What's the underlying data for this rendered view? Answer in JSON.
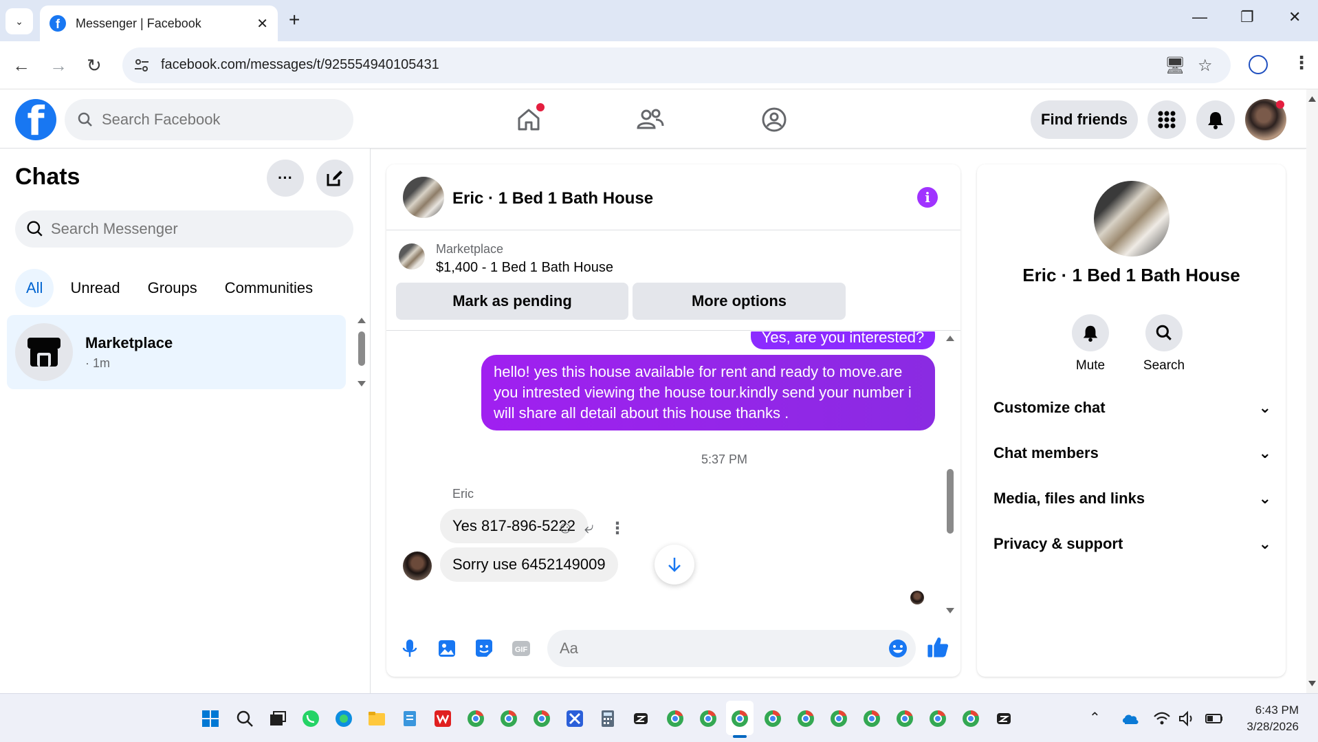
{
  "browser": {
    "tab_title": "Messenger | Facebook",
    "url": "facebook.com/messages/t/925554940105431"
  },
  "fb": {
    "search_placeholder": "Search Facebook",
    "find_friends": "Find friends"
  },
  "sidebar": {
    "title": "Chats",
    "search_placeholder": "Search Messenger",
    "filters": [
      "All",
      "Unread",
      "Groups",
      "Communities"
    ],
    "active_filter": "All",
    "chats": [
      {
        "name": "Marketplace",
        "meta": "· 1m"
      }
    ]
  },
  "conversation": {
    "title": "Eric · 1 Bed 1 Bath House",
    "listing": {
      "label": "Marketplace",
      "price_title": "$1,400 - 1 Bed 1 Bath House",
      "mark_pending": "Mark as pending",
      "more_options": "More options"
    },
    "messages": {
      "out_partial": "Yes, are you interested?",
      "out_main": "hello! yes this house available for rent and ready to move.are you intrested viewing the house tour.kindly send your number i will share all detail about this house thanks .",
      "timestamp": "5:37 PM",
      "sender": "Eric",
      "in_1": "Yes 817-896-5222",
      "in_2": "Sorry use 6452149009"
    },
    "composer_placeholder": "Aa"
  },
  "right_panel": {
    "title": "Eric · 1 Bed 1 Bath House",
    "actions": [
      "Mute",
      "Search"
    ],
    "sections": [
      "Customize chat",
      "Chat members",
      "Media, files and links",
      "Privacy & support"
    ]
  },
  "taskbar": {
    "time": "6:43 PM",
    "date": "3/28/2026"
  },
  "colors": {
    "fb_blue": "#1877f2",
    "messenger_purple": "#8c2bff",
    "notification_red": "#e41e3f"
  }
}
